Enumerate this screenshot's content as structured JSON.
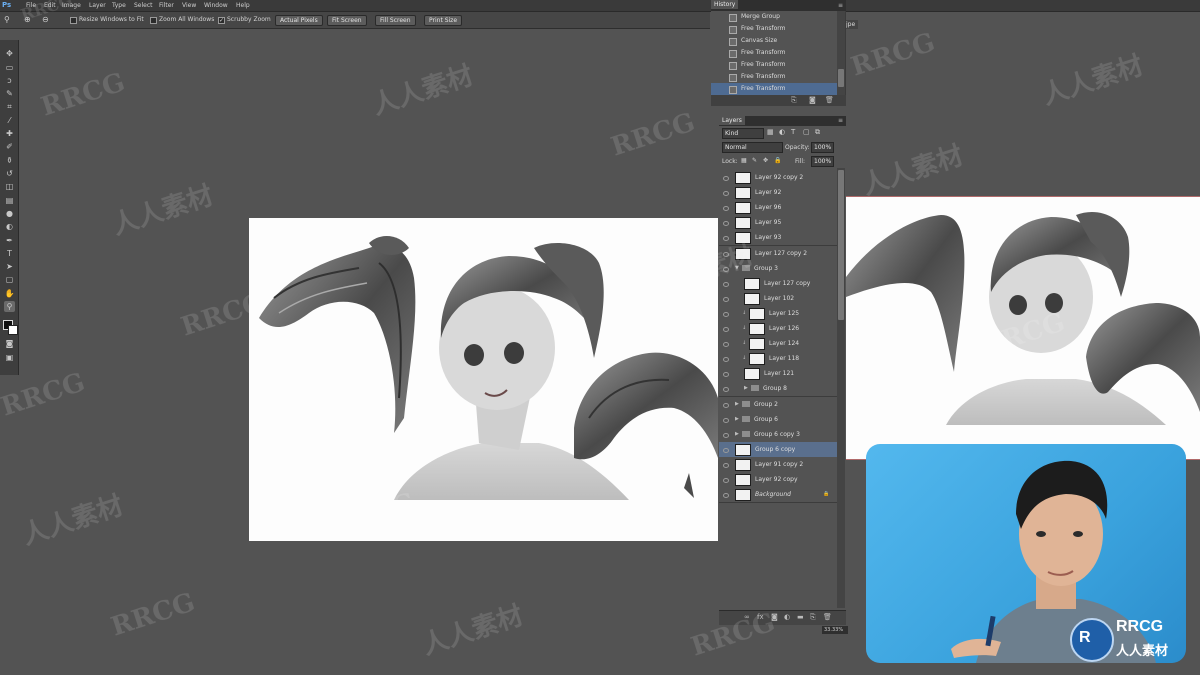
{
  "app": {
    "logo": "Ps"
  },
  "menu": [
    "File",
    "Edit",
    "Image",
    "Layer",
    "Type",
    "Select",
    "Filter",
    "View",
    "Window",
    "Help"
  ],
  "options": {
    "resize_windows_label": "Resize Windows to Fit",
    "zoom_all_label": "Zoom All Windows",
    "scrubby_zoom_label": "Scrubby Zoom",
    "scrubby_checked": true,
    "buttons": [
      "Actual Pixels",
      "Fit Screen",
      "Fill Screen",
      "Print Size"
    ]
  },
  "history": {
    "tab": "History",
    "items": [
      {
        "label": "Merge Group",
        "sel": false
      },
      {
        "label": "Free Transform",
        "sel": false
      },
      {
        "label": "Canvas Size",
        "sel": false
      },
      {
        "label": "Free Transform",
        "sel": false
      },
      {
        "label": "Free Transform",
        "sel": false
      },
      {
        "label": "Free Transform",
        "sel": false
      },
      {
        "label": "Free Transform",
        "sel": true
      }
    ]
  },
  "layers": {
    "tab": "Layers",
    "kind": "Kind",
    "blend": "Normal",
    "opacity_label": "Opacity:",
    "opacity": "100%",
    "lock_label": "Lock:",
    "fill_label": "Fill:",
    "fill": "100%",
    "rows": [
      {
        "name": "Layer 92 copy 2",
        "type": "layer",
        "indent": 0,
        "sel": false
      },
      {
        "name": "Layer 92",
        "type": "layer",
        "indent": 0,
        "sel": false
      },
      {
        "name": "Layer 96",
        "type": "layer",
        "indent": 0,
        "sel": false
      },
      {
        "name": "Layer 95",
        "type": "layer",
        "indent": 0,
        "sel": false
      },
      {
        "name": "Layer 93",
        "type": "layer",
        "indent": 0,
        "sel": false
      },
      {
        "name": "Layer 127 copy 2",
        "type": "layer",
        "indent": 0,
        "sel": false
      },
      {
        "name": "Group 3",
        "type": "group-open",
        "indent": 0,
        "sel": false
      },
      {
        "name": "Layer 127 copy",
        "type": "layer",
        "indent": 1,
        "sel": false
      },
      {
        "name": "Layer 102",
        "type": "layer",
        "indent": 1,
        "sel": false
      },
      {
        "name": "Layer 125",
        "type": "clip",
        "indent": 1,
        "sel": false
      },
      {
        "name": "Layer 126",
        "type": "clip",
        "indent": 1,
        "sel": false
      },
      {
        "name": "Layer 124",
        "type": "clip",
        "indent": 1,
        "sel": false
      },
      {
        "name": "Layer 118",
        "type": "clip",
        "indent": 1,
        "sel": false
      },
      {
        "name": "Layer 121",
        "type": "layer",
        "indent": 1,
        "sel": false
      },
      {
        "name": "Group 8",
        "type": "group",
        "indent": 1,
        "sel": false
      },
      {
        "name": "Group 2",
        "type": "group",
        "indent": 0,
        "sel": false
      },
      {
        "name": "Group 6",
        "type": "group",
        "indent": 0,
        "sel": false
      },
      {
        "name": "Group 6 copy 3",
        "type": "group",
        "indent": 0,
        "sel": false
      },
      {
        "name": "Group 6 copy",
        "type": "layer",
        "indent": 0,
        "sel": true
      },
      {
        "name": "Layer 91 copy 2",
        "type": "layer",
        "indent": 0,
        "sel": false
      },
      {
        "name": "Layer 92 copy",
        "type": "layer",
        "indent": 0,
        "sel": false
      },
      {
        "name": "Background",
        "type": "bg",
        "indent": 0,
        "sel": false
      }
    ]
  },
  "zoom": "33.33%",
  "preview_tab_fragment": "jpe",
  "watermarks": {
    "latin": "RRCG",
    "cjk": "人人素材"
  },
  "badge": {
    "line1": "RRCG",
    "line2": "人人素材"
  },
  "colors": {
    "accent": "#4e6b92",
    "canvas_bg": "#535353",
    "webcam_bg": "#3aa2dd"
  }
}
